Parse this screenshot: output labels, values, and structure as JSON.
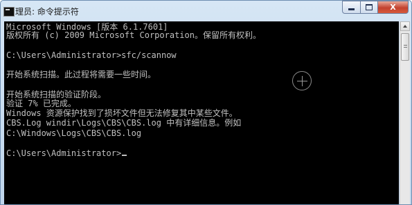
{
  "window": {
    "title": "理员: 命令提示符",
    "controls": {
      "minimize": "minimize",
      "maximize": "maximize",
      "close": "X"
    }
  },
  "console": {
    "lines": [
      "Microsoft Windows [版本 6.1.7601]",
      "版权所有 (c) 2009 Microsoft Corporation。保留所有权利。",
      "",
      "C:\\Users\\Administrator>sfc/scannow",
      "",
      "开始系统扫描。此过程将需要一些时间。",
      "",
      "开始系统扫描的验证阶段。",
      "验证 7% 已完成。",
      "Windows 资源保护找到了损坏文件但无法修复其中某些文件。",
      "CBS.Log windir\\Logs\\CBS\\CBS.log 中有详细信息。例如",
      "C:\\Windows\\Logs\\CBS\\CBS.log",
      "",
      "C:\\Users\\Administrator>"
    ]
  },
  "colors": {
    "console_bg": "#000000",
    "console_text": "#c0c0c0",
    "titlebar": "#d6e6f5",
    "close_button": "#c3422f"
  }
}
